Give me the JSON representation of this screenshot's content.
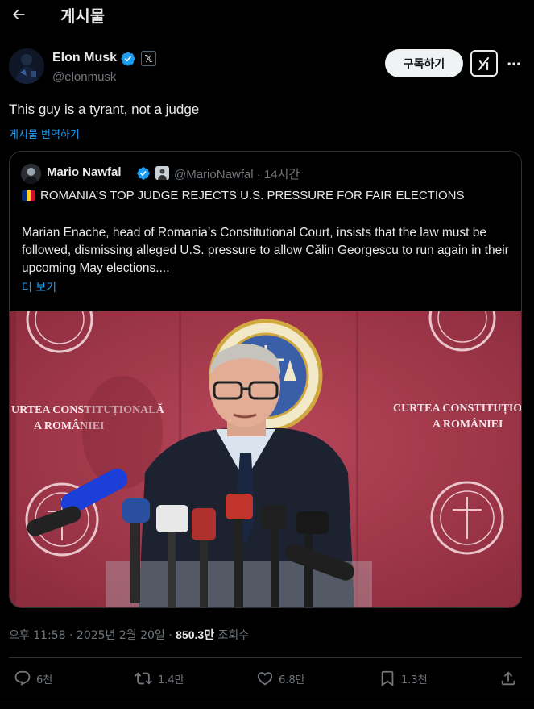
{
  "topbar": {
    "title": "게시물"
  },
  "author": {
    "name": "Elon Musk",
    "handle": "@elonmusk",
    "affiliation_badge": "𝕏"
  },
  "buttons": {
    "subscribe": "구독하기"
  },
  "post": {
    "text": "This guy is a tyrant, not a judge",
    "translate": "게시물 번역하기"
  },
  "quote": {
    "name": "Mario Nawfal",
    "handle": "@MarioNawfal",
    "time": "· 14시간",
    "headline": "ROMANIA’S TOP JUDGE REJECTS U.S. PRESSURE FOR FAIR ELECTIONS",
    "body": "Marian Enache, head of Romania’s Constitutional Court, insists that the law must be followed, dismissing alleged U.S. pressure to allow Călin Georgescu to run again in their upcoming May elections....",
    "show_more": "더 보기",
    "image": {
      "wall_text_left": [
        "URTEA CONSTITUȚIONALĂ",
        "A ROMÂNIEI"
      ],
      "wall_text_right": [
        "CURTEA CONSTITUȚIONA",
        "A ROMÂNIEI"
      ]
    }
  },
  "meta": {
    "timestamp": "오후 11:58 · 2025년 2월 20일 · ",
    "views_count": "850.3만",
    "views_label": " 조회수"
  },
  "actions": {
    "replies": "6천",
    "reposts": "1.4만",
    "likes": "6.8만",
    "bookmarks": "1.3천"
  },
  "colors": {
    "background": "#000000",
    "accent": "#1d9bf0",
    "muted": "#71767b",
    "text": "#e7e9ea",
    "border": "#2f3336"
  },
  "icons": {
    "back": "arrow-left-icon",
    "verified": "verified-badge-icon",
    "grok": "grok-icon",
    "more": "more-dots-icon",
    "reply": "reply-icon",
    "repost": "repost-icon",
    "like": "heart-icon",
    "bookmark": "bookmark-icon",
    "share": "share-icon"
  }
}
